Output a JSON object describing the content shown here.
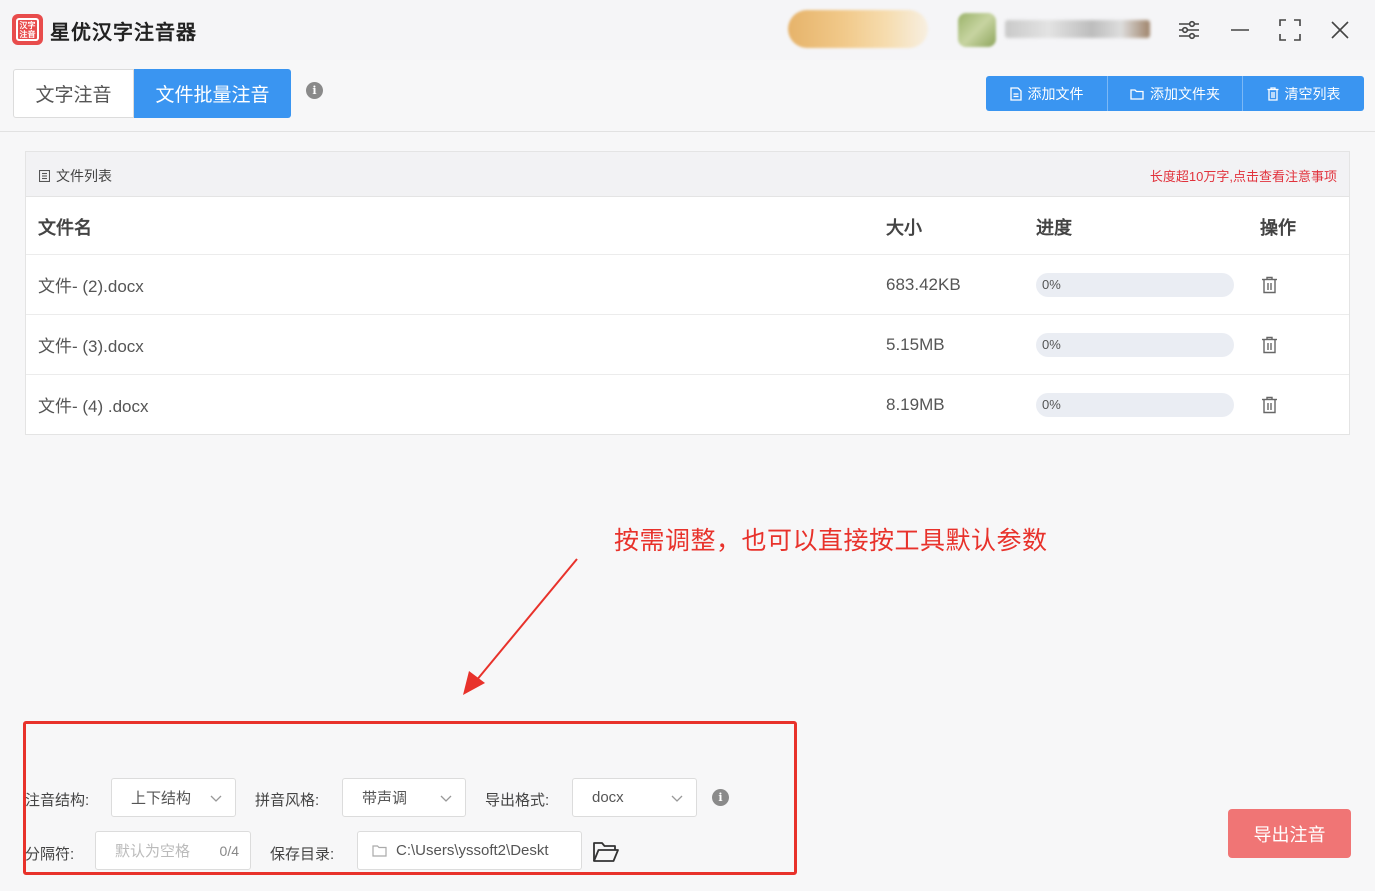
{
  "app": {
    "title": "星优汉字注音器",
    "logo_text": "汉字注音"
  },
  "tabs": [
    {
      "label": "文字注音",
      "active": false
    },
    {
      "label": "文件批量注音",
      "active": true
    }
  ],
  "toolbar": {
    "add_file": "添加文件",
    "add_folder": "添加文件夹",
    "clear_list": "清空列表"
  },
  "file_panel": {
    "title": "文件列表",
    "notice": "长度超10万字,点击查看注意事项",
    "columns": {
      "name": "文件名",
      "size": "大小",
      "progress": "进度",
      "action": "操作"
    },
    "rows": [
      {
        "name": "文件- (2).docx",
        "size": "683.42KB",
        "progress": "0%"
      },
      {
        "name": "文件- (3).docx",
        "size": "5.15MB",
        "progress": "0%"
      },
      {
        "name": "文件- (4) .docx",
        "size": "8.19MB",
        "progress": "0%"
      }
    ]
  },
  "annotation": {
    "hint": "按需调整，也可以直接按工具默认参数"
  },
  "settings": {
    "structure_label": "注音结构:",
    "structure_value": "上下结构",
    "pinyin_label": "拼音风格:",
    "pinyin_value": "带声调",
    "format_label": "导出格式:",
    "format_value": "docx",
    "separator_label": "分隔符:",
    "separator_placeholder": "默认为空格",
    "separator_count": "0/4",
    "save_label": "保存目录:",
    "save_value": "C:\\Users\\yssoft2\\Deskt"
  },
  "export_button": "导出注音",
  "colors": {
    "accent": "#3a95f1",
    "danger": "#e8322b",
    "export": "#f07575"
  }
}
